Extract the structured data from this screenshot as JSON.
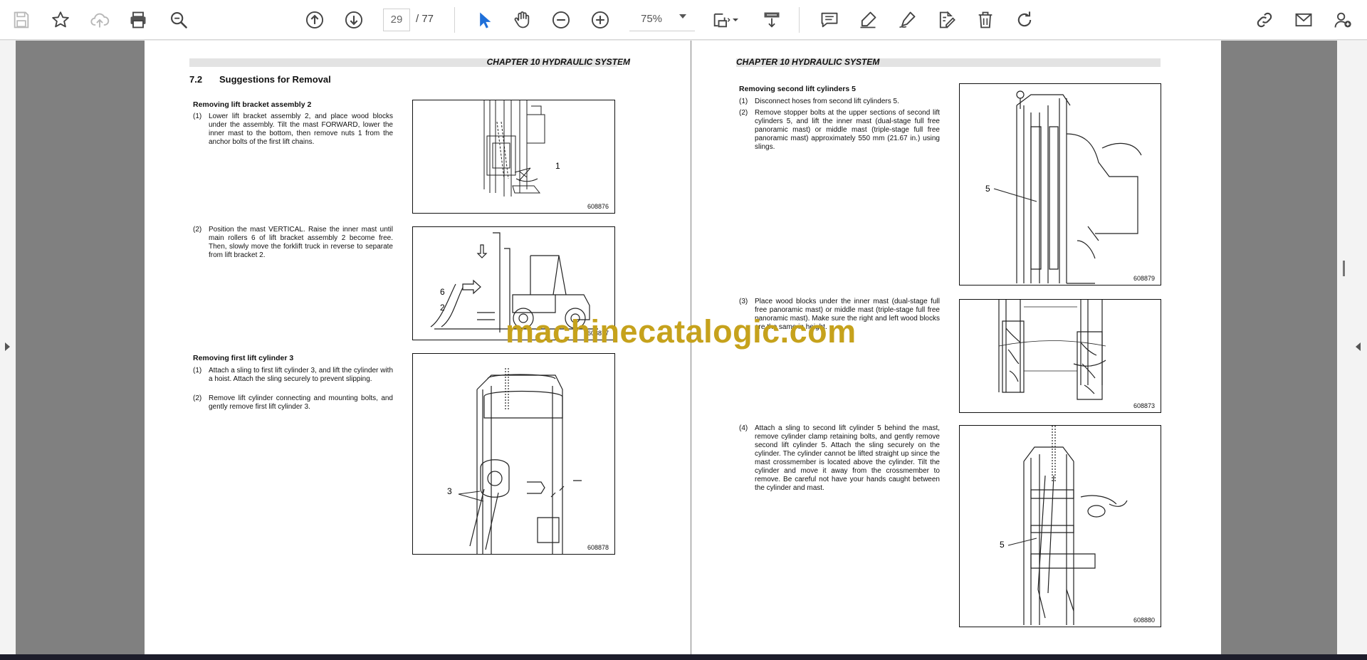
{
  "toolbar": {
    "page_current": "29",
    "page_total": "/ 77",
    "zoom": "75%",
    "left_icons": [
      "save-icon",
      "bookmark-star-icon",
      "cloud-upload-icon",
      "print-icon",
      "zoom-out-magnifier-icon"
    ],
    "nav_icons": [
      "previous-page-icon",
      "next-page-icon"
    ],
    "tool_icons": [
      "select-cursor-icon",
      "hand-pan-icon",
      "zoom-minus-icon",
      "zoom-plus-icon"
    ],
    "right_icons": [
      "comment-icon",
      "highlight-pen-icon",
      "sign-pen-icon",
      "edit-text-icon",
      "delete-icon",
      "redo-icon"
    ],
    "far_right_icons": [
      "share-link-icon",
      "email-icon",
      "add-user-icon"
    ],
    "accent": "#1e6fd9"
  },
  "left_page": {
    "header": "CHAPTER 10 HYDRAULIC SYSTEM",
    "section_number": "7.2",
    "section_title": "Suggestions for Removal",
    "blocks": [
      {
        "subtitle": "Removing lift bracket assembly 2",
        "steps": [
          {
            "num": "(1)",
            "text": "Lower lift bracket assembly 2, and place wood blocks under the assembly. Tilt the mast FORWARD, lower the inner mast to the bottom, then remove nuts 1 from the anchor bolts of the first lift chains."
          }
        ],
        "figure_id": "608876",
        "callouts": [
          "1"
        ]
      },
      {
        "subtitle": "",
        "steps": [
          {
            "num": "(2)",
            "text": "Position the mast VERTICAL. Raise the inner mast until main rollers 6 of lift bracket assembly 2 become free. Then, slowly move the forklift truck in reverse to separate from lift bracket 2."
          }
        ],
        "figure_id": "608877",
        "callouts": [
          "6",
          "2"
        ]
      },
      {
        "subtitle": "Removing first lift cylinder 3",
        "steps": [
          {
            "num": "(1)",
            "text": "Attach a sling to first lift cylinder 3, and lift the cylinder with a hoist. Attach the sling securely to prevent slipping."
          },
          {
            "num": "(2)",
            "text": "Remove lift cylinder connecting and mounting bolts, and gently remove first lift cylinder 3."
          }
        ],
        "figure_id": "608878",
        "callouts": [
          "3"
        ]
      }
    ]
  },
  "right_page": {
    "header": "CHAPTER 10 HYDRAULIC SYSTEM",
    "blocks": [
      {
        "subtitle": "Removing second lift cylinders 5",
        "steps": [
          {
            "num": "(1)",
            "text": "Disconnect hoses from second lift cylinders 5."
          },
          {
            "num": "(2)",
            "text": "Remove stopper bolts at the upper sections of second lift cylinders 5, and lift the inner mast (dual-stage full free panoramic mast) or middle mast (triple-stage full free panoramic mast) approximately 550 mm (21.67 in.) using slings."
          }
        ],
        "figure_id": "608879",
        "callouts": [
          "5"
        ]
      },
      {
        "subtitle": "",
        "steps": [
          {
            "num": "(3)",
            "text": "Place wood blocks under the inner mast (dual-stage full free panoramic mast) or middle mast (triple-stage full free panoramic mast). Make sure the right and left wood blocks are the same in height."
          }
        ],
        "figure_id": "608873",
        "callouts": []
      },
      {
        "subtitle": "",
        "steps": [
          {
            "num": "(4)",
            "text": "Attach a sling to second lift cylinder 5 behind the mast, remove cylinder clamp retaining bolts, and gently remove second lift cylinder 5. Attach the sling securely on the cylinder. The cylinder cannot be lifted straight up since the mast crossmember is located above the cylinder. Tilt the cylinder and move it away from the crossmember to remove. Be careful not have your hands caught between the cylinder and mast."
          }
        ],
        "figure_id": "608880",
        "callouts": [
          "5"
        ]
      }
    ]
  },
  "watermark": "machinecatalogic.com"
}
